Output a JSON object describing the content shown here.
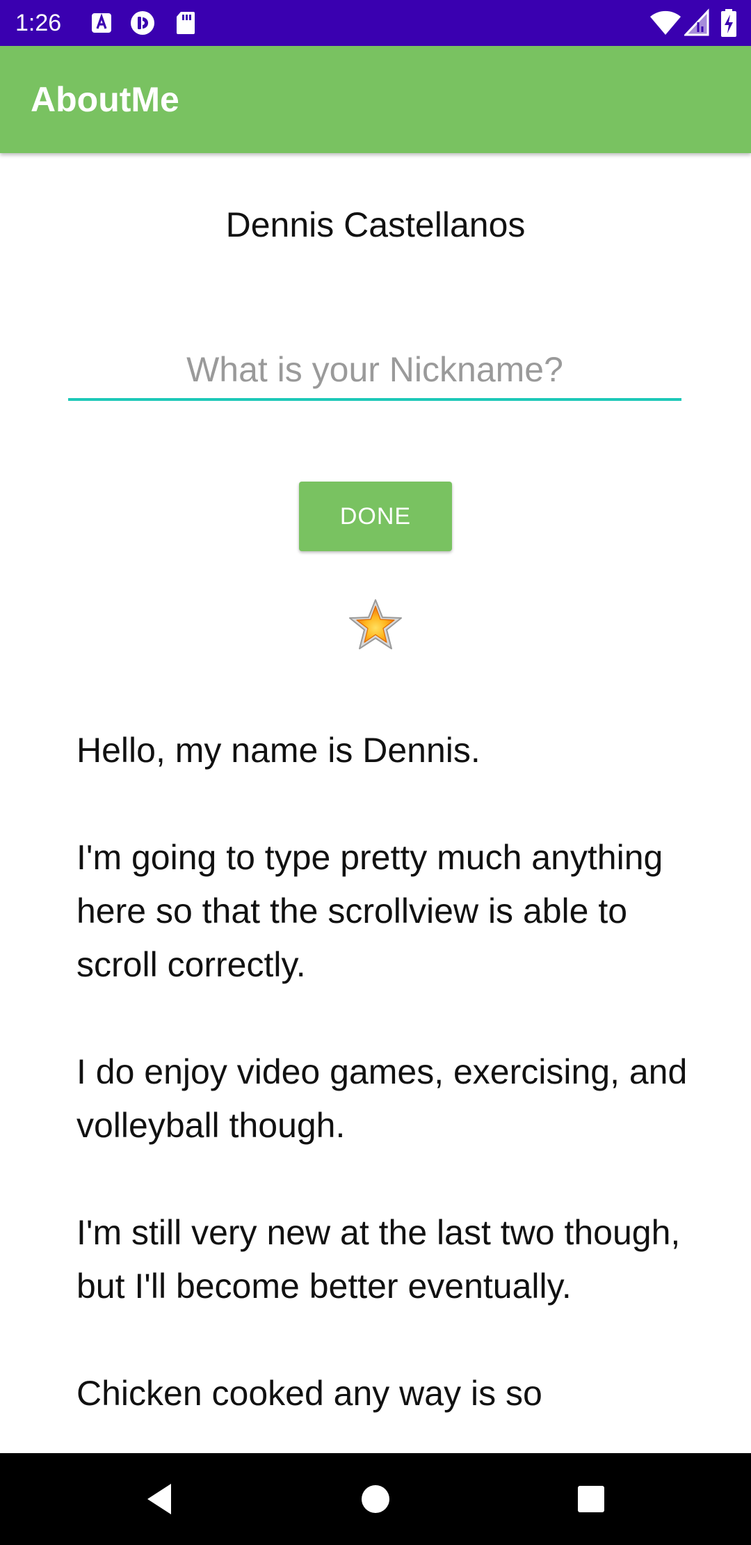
{
  "status_bar": {
    "time": "1:26",
    "notification_icons": [
      "a-badge-icon",
      "pocket-casts-icon",
      "sd-card-icon"
    ],
    "right_icons": [
      "wifi-icon",
      "signal-icon",
      "battery-charging-icon"
    ],
    "background": "#3a00b0"
  },
  "app_bar": {
    "title": "AboutMe",
    "background": "#79c261"
  },
  "profile": {
    "name": "Dennis Castellanos",
    "nickname_placeholder": "What is your Nickname?",
    "nickname_value": "",
    "done_label": "DONE",
    "star_icon": "star-icon"
  },
  "bio": {
    "text": "Hello, my name is Dennis.\n\nI'm going to type pretty much anything here so that the scrollview is able to scroll correctly.\n\nI do enjoy video games, exercising, and volleyball though.\n\nI'm still very new at the last two though, but I'll become better eventually.\n\nChicken cooked any way is so"
  },
  "nav_bar": {
    "buttons": [
      "back-icon",
      "home-icon",
      "recents-icon"
    ]
  },
  "colors": {
    "accent": "#79c261",
    "underline": "#1ec8b8",
    "status_bar": "#3a00b0"
  }
}
